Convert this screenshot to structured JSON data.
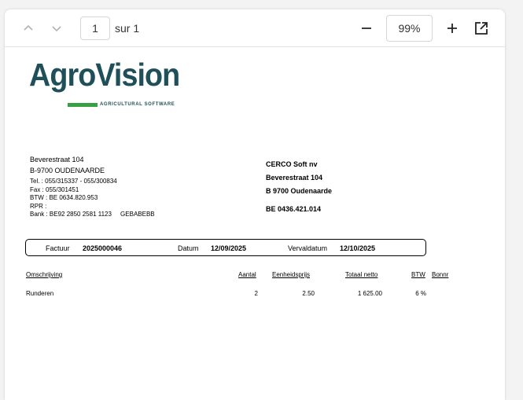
{
  "toolbar": {
    "page_current": "1",
    "page_total": "sur 1",
    "zoom": "99%"
  },
  "logo": {
    "name": "AgroVision",
    "tagline": "AGRICULTURAL SOFTWARE"
  },
  "sender": {
    "street": "Beverestraat 104",
    "city": "B-9700 OUDENAARDE",
    "tel": "Tel. : 055/315337 - 055/300834",
    "fax": "Fax : 055/301451",
    "btw": "BTW : BE 0634.820.953",
    "rpr": "RPR :",
    "bank": "Bank : BE92 2850 2581 1123     GEBABEBB"
  },
  "recipient": {
    "name": "CERCO Soft nv",
    "street": "Beverestraat 104",
    "city": "B 9700 Oudenaarde",
    "vat": "BE 0436.421.014"
  },
  "invoice": {
    "factuur_label": "Factuur",
    "factuur_value": "2025000046",
    "datum_label": "Datum",
    "datum_value": "12/09/2025",
    "vervaldatum_label": "Vervaldatum",
    "vervaldatum_value": "12/10/2025"
  },
  "table": {
    "headers": [
      "Omschrijving",
      "Aantal",
      "Eenheidsprijs",
      "Totaal netto",
      "BTW",
      "Bonnr"
    ],
    "rows": [
      [
        "Runderen",
        "2",
        "2.50",
        "1 625.00",
        "6 %",
        ""
      ]
    ]
  },
  "colors": {
    "logo_text": "#1f4f59",
    "logo_accent": "#36a043"
  }
}
